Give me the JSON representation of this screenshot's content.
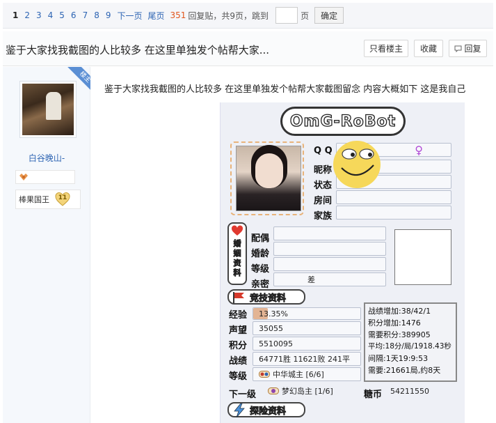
{
  "pager": {
    "pages": [
      "1",
      "2",
      "3",
      "4",
      "5",
      "6",
      "7",
      "8",
      "9"
    ],
    "current": "1",
    "next_label": "下一页",
    "last_label": "尾页",
    "reply_count": "351",
    "reply_suffix": "回复贴，共9页，跳到",
    "page_unit": "页",
    "confirm_label": "确定"
  },
  "thread": {
    "title": "鉴于大家找我截图的人比较多 在这里单独发个帖帮大家...",
    "only_op_label": "只看楼主",
    "favorite_label": "收藏",
    "reply_label": "回复"
  },
  "author": {
    "badge": "楼主",
    "name": "白谷晚山-",
    "title": "棒果国王",
    "level": "11"
  },
  "post": {
    "text": "鉴于大家找我截图的人比较多 在这里单独发个帖帮大家截图留念 内容大概如下 这是我自己"
  },
  "screenshot": {
    "logo": "OmG-RoBot",
    "qq_label": "Q Q",
    "gender_symbol": "♀",
    "nickname_label": "昵称",
    "status_label": "状态",
    "room_label": "房间",
    "family_label": "家族",
    "marriage_tab": "婚姻资料",
    "spouse_label": "配偶",
    "marriage_age_label": "婚龄",
    "grade_label": "等级",
    "intimacy_label": "亲密",
    "intimacy_value": "差",
    "competition_banner": "竞技资料",
    "exp_label": "经验",
    "exp_value": "13.35%",
    "exp_fraction": 0.1335,
    "prestige_label": "声望",
    "prestige_value": "35055",
    "points_label": "积分",
    "points_value": "5510095",
    "record_label": "战绩",
    "record_value": "64771胜 11621败 241平",
    "level_label": "等级",
    "level_value": "中华城主 [6/6]",
    "next_level_label": "下一级",
    "next_level_value": "梦幻岛主 [1/6]",
    "stats": [
      "战绩增加:38/42/1",
      "积分增加:1476",
      "需要积分:389905",
      "平均:18分/局/1918.43秒",
      "间隔:1天19:9:53",
      "需要:21661局,约8天"
    ],
    "coins_label": "糖币",
    "coins_value": "54211550",
    "adventure_banner": "探险资料"
  },
  "colors": {
    "link": "#2d64b3",
    "count": "#e1551c",
    "gender": "#b04ad6",
    "exp_bar": "#e3b494"
  }
}
